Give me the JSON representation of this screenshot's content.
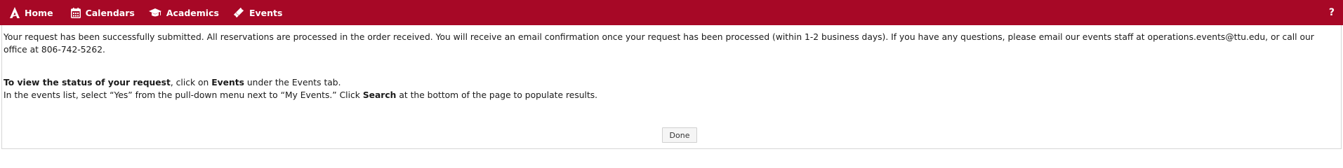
{
  "nav": {
    "items": [
      {
        "label": "Home",
        "icon": "home-logo-icon"
      },
      {
        "label": "Calendars",
        "icon": "calendar-icon"
      },
      {
        "label": "Academics",
        "icon": "graduation-cap-icon"
      },
      {
        "label": "Events",
        "icon": "ticket-icon"
      }
    ],
    "help": "?"
  },
  "colors": {
    "brand": "#a70826",
    "background": "#ffffff",
    "text": "#1a1a1a"
  },
  "message": {
    "confirmation": "Your request has been successfully submitted. All reservations are processed in the order received. You will receive an email confirmation once your request has been processed (within 1-2 business days). If you have any questions, please email our events staff at operations.events@ttu.edu, or call our office at 806-742-5262.",
    "status_bold": "To view the status of your request",
    "status_mid": ", click on ",
    "status_events": "Events",
    "status_end": " under the Events tab.",
    "instruction_start": "In the events list, select “Yes” from the pull-down menu next to “My Events.” Click ",
    "instruction_search": "Search",
    "instruction_end": " at the bottom of the page to populate results."
  },
  "done_button": "Done"
}
